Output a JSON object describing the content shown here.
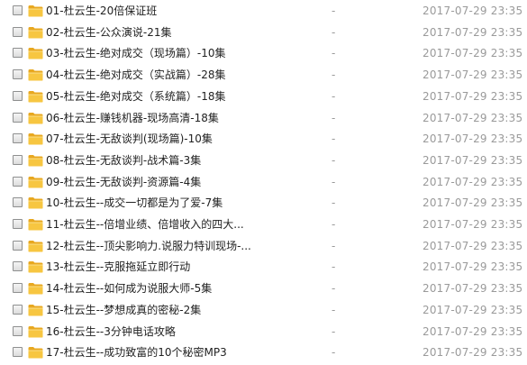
{
  "files": [
    {
      "name": "01-杜云生-20倍保证班",
      "size": "-",
      "date": "2017-07-29 23:35"
    },
    {
      "name": "02-杜云生-公众演说-21集",
      "size": "-",
      "date": "2017-07-29 23:35"
    },
    {
      "name": "03-杜云生-绝对成交（现场篇）-10集",
      "size": "-",
      "date": "2017-07-29 23:35"
    },
    {
      "name": "04-杜云生-绝对成交（实战篇）-28集",
      "size": "-",
      "date": "2017-07-29 23:35"
    },
    {
      "name": "05-杜云生-绝对成交（系统篇）-18集",
      "size": "-",
      "date": "2017-07-29 23:35"
    },
    {
      "name": "06-杜云生-赚钱机器-现场高清-18集",
      "size": "-",
      "date": "2017-07-29 23:35"
    },
    {
      "name": "07-杜云生-无敌谈判(现场篇)-10集",
      "size": "-",
      "date": "2017-07-29 23:35"
    },
    {
      "name": "08-杜云生-无敌谈判-战术篇-3集",
      "size": "-",
      "date": "2017-07-29 23:35"
    },
    {
      "name": "09-杜云生-无敌谈判-资源篇-4集",
      "size": "-",
      "date": "2017-07-29 23:35"
    },
    {
      "name": "10-杜云生--成交一切都是为了爱-7集",
      "size": "-",
      "date": "2017-07-29 23:35"
    },
    {
      "name": "11-杜云生--倍增业绩、倍增收入的四大...",
      "size": "-",
      "date": "2017-07-29 23:35"
    },
    {
      "name": "12-杜云生--顶尖影响力.说服力特训现场-...",
      "size": "-",
      "date": "2017-07-29 23:35"
    },
    {
      "name": "13-杜云生--克服拖延立即行动",
      "size": "-",
      "date": "2017-07-29 23:35"
    },
    {
      "name": "14-杜云生--如何成为说服大师-5集",
      "size": "-",
      "date": "2017-07-29 23:35"
    },
    {
      "name": "15-杜云生--梦想成真的密秘-2集",
      "size": "-",
      "date": "2017-07-29 23:35"
    },
    {
      "name": "16-杜云生--3分钟电话攻略",
      "size": "-",
      "date": "2017-07-29 23:35"
    },
    {
      "name": "17-杜云生--成功致富的10个秘密MP3",
      "size": "-",
      "date": "2017-07-29 23:35"
    }
  ],
  "colors": {
    "folder_front": "#f7c641",
    "folder_back": "#e8a820",
    "meta_text": "#9a9a9a"
  },
  "icons": {
    "row_icon": "folder-icon",
    "row_checkbox": "checkbox"
  }
}
